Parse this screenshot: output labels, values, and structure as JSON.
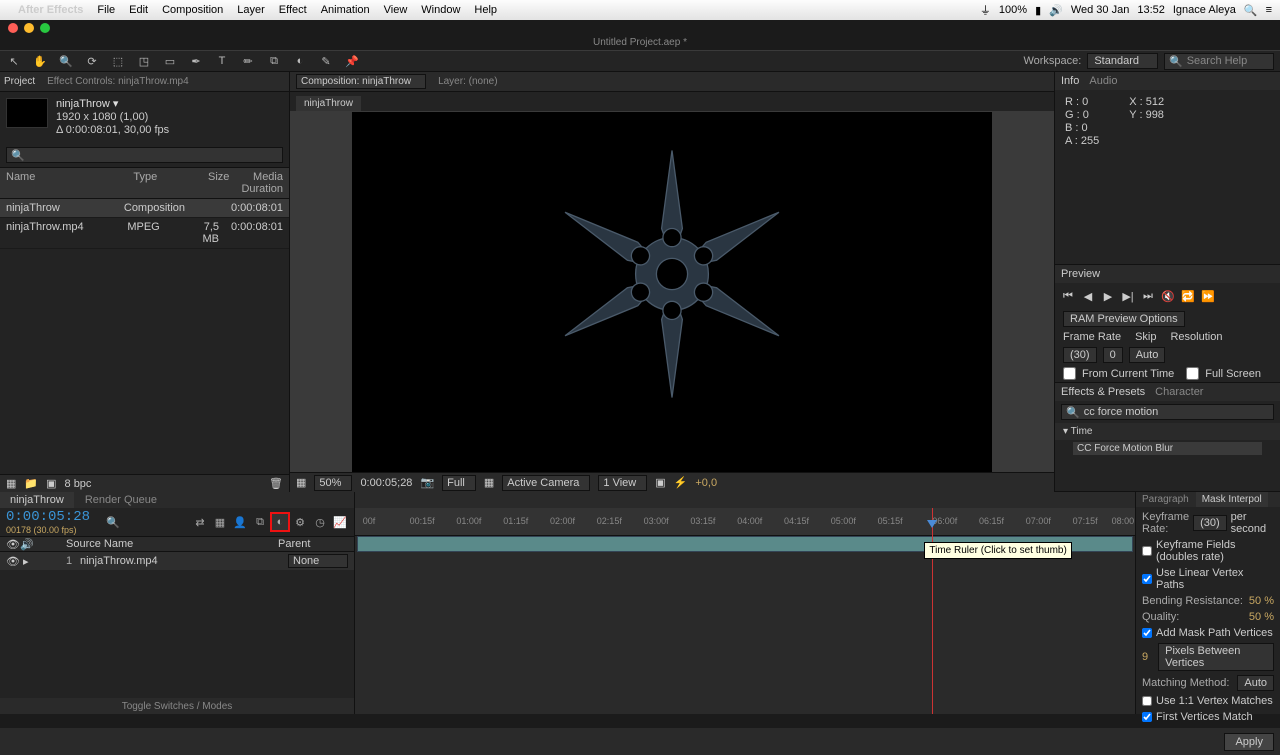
{
  "menubar": {
    "app": "After Effects",
    "items": [
      "File",
      "Edit",
      "Composition",
      "Layer",
      "Effect",
      "Animation",
      "View",
      "Window",
      "Help"
    ],
    "battery": "100%",
    "date": "Wed 30 Jan",
    "time": "13:52",
    "user": "Ignace Aleya"
  },
  "window_title": "Untitled Project.aep *",
  "workspace": {
    "label": "Workspace:",
    "value": "Standard",
    "search_placeholder": "Search Help"
  },
  "project": {
    "tab": "Project",
    "effect_controls": "Effect Controls: ninjaThrow.mp4",
    "asset": {
      "name": "ninjaThrow ▾",
      "dims": "1920 x 1080 (1,00)",
      "dur": "Δ 0:00:08:01, 30,00 fps"
    },
    "columns": {
      "name": "Name",
      "type": "Type",
      "size": "Size",
      "dur": "Media Duration"
    },
    "rows": [
      {
        "name": "ninjaThrow",
        "type": "Composition",
        "size": "",
        "dur": "0:00:08:01"
      },
      {
        "name": "ninjaThrow.mp4",
        "type": "MPEG",
        "size": "7,5 MB",
        "dur": "0:00:08:01"
      }
    ],
    "footer_bpc": "8 bpc"
  },
  "composition": {
    "dropdown": "Composition: ninjaThrow",
    "layer_none": "Layer: (none)",
    "tab": "ninjaThrow",
    "footer": {
      "zoom": "50%",
      "tc": "0:00:05;28",
      "res": "Full",
      "camera": "Active Camera",
      "view": "1 View",
      "exposure": "+0,0"
    }
  },
  "info": {
    "tab": "Info",
    "audio_tab": "Audio",
    "r": "R : 0",
    "g": "G : 0",
    "b": "B : 0",
    "a": "A : 255",
    "x": "X : 512",
    "y": "Y : 998"
  },
  "preview": {
    "tab": "Preview",
    "options": "RAM Preview Options",
    "framerate_lbl": "Frame Rate",
    "skip_lbl": "Skip",
    "res_lbl": "Resolution",
    "framerate": "(30)",
    "skip": "0",
    "res": "Auto",
    "from_current": "From Current Time",
    "full_screen": "Full Screen"
  },
  "effects_presets": {
    "tab": "Effects & Presets",
    "char_tab": "Character",
    "search": "cc force motion",
    "cat": "▾ Time",
    "item": "CC Force Motion Blur"
  },
  "timeline": {
    "tab": "ninjaThrow",
    "rq": "Render Queue",
    "timecode": "0:00:05:28",
    "frames": "00178 (30.00 fps)",
    "src": "Source Name",
    "parent": "Parent",
    "layer": {
      "num": "1",
      "name": "ninjaThrow.mp4",
      "parent": "None"
    },
    "ticks": [
      "00f",
      "00:15f",
      "01:00f",
      "01:15f",
      "02:00f",
      "02:15f",
      "03:00f",
      "03:15f",
      "04:00f",
      "04:15f",
      "05:00f",
      "05:15f",
      "06:00f",
      "06:15f",
      "07:00f",
      "07:15f",
      "08:00"
    ],
    "tooltip": "Time Ruler (Click to set thumb)",
    "toggle": "Toggle Switches / Modes"
  },
  "mask_interp": {
    "tab_para": "Paragraph",
    "tab_mask": "Mask Interpol",
    "kf_rate": "Keyframe Rate:",
    "kf_rate_val": "(30)",
    "per_sec": "per second",
    "kf_fields": "Keyframe Fields (doubles rate)",
    "linear": "Use Linear Vertex Paths",
    "bend": "Bending Resistance:",
    "bend_val": "50 %",
    "quality": "Quality:",
    "quality_val": "50 %",
    "add_vert": "Add Mask Path Vertices",
    "pix_between": "Pixels Between Vertices",
    "pix_val": "9",
    "match": "Matching Method:",
    "match_val": "Auto",
    "use11": "Use 1:1 Vertex Matches",
    "first": "First Vertices Match",
    "apply": "Apply"
  }
}
